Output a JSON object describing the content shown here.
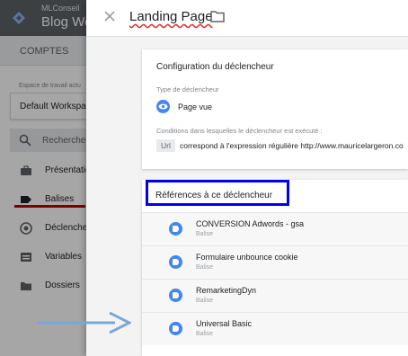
{
  "sidebar": {
    "account": "MLConseil",
    "container": "Blog We",
    "tabs": [
      "COMPTES"
    ],
    "workspace_label": "Espace de travail actu",
    "workspace_name": "Default Workspace",
    "search_placeholder": "Rechercher",
    "nav": [
      {
        "label": "Présentation",
        "icon": "briefcase-icon"
      },
      {
        "label": "Balises",
        "icon": "tag-icon"
      },
      {
        "label": "Déclencheurs",
        "icon": "trigger-icon"
      },
      {
        "label": "Variables",
        "icon": "variables-icon"
      },
      {
        "label": "Dossiers",
        "icon": "folder-icon"
      }
    ]
  },
  "panel": {
    "title": "Landing Page",
    "config": {
      "heading": "Configuration du déclencheur",
      "type_label": "Type de déclencheur",
      "type_value": "Page vue",
      "conditions_label": "Conditions dans lesquelles le déclencheur est exécuté :",
      "condition_chip": "Url",
      "condition_text": "correspond à l'expression régulière http://www.mauricelargeron.co"
    },
    "references": {
      "heading": "Références à ce déclencheur",
      "tags": [
        {
          "name": "CONVERSION Adwords - gsa",
          "kind": "Balise"
        },
        {
          "name": "Formulaire unbounce cookie",
          "kind": "Balise"
        },
        {
          "name": "RemarketingDyn",
          "kind": "Balise"
        },
        {
          "name": "Universal Basic",
          "kind": "Balise"
        }
      ]
    }
  },
  "colors": {
    "accent": "#4285f4",
    "highlight_box": "#0000ee",
    "red_underline": "#c00000",
    "arrow": "#7ba6dc"
  }
}
